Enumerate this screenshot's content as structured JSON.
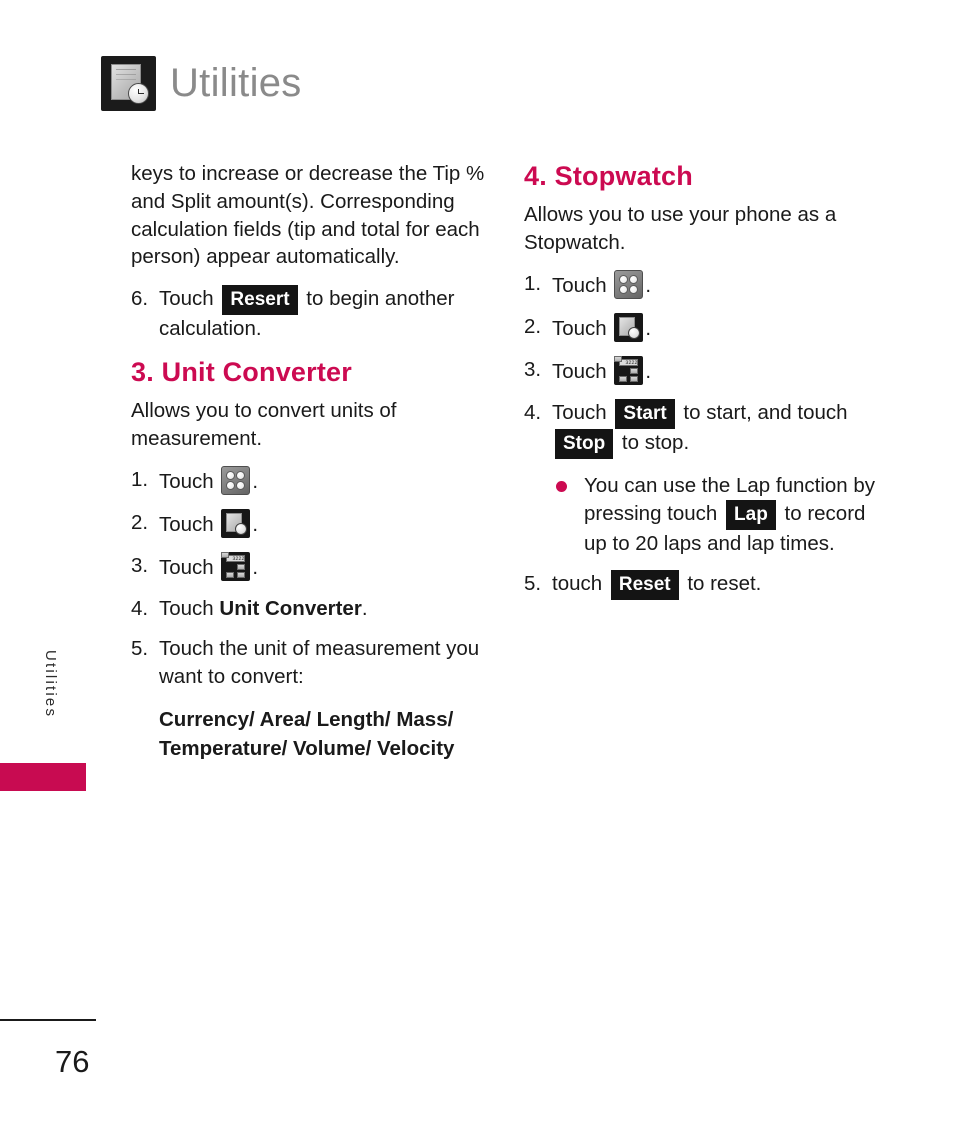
{
  "header": {
    "title": "Utilities",
    "icon": "utilities-clock-icon"
  },
  "side_tab": {
    "label": "Utilities",
    "color": "#c80b51"
  },
  "footer": {
    "page_number": "76"
  },
  "theme": {
    "heading_color": "#cc0a51",
    "bullet_color": "#cc0a51",
    "chip_bg": "#141414",
    "header_title_color": "#8a8a8a"
  },
  "left_column": {
    "continued_paragraph": "keys to increase or decrease the Tip % and Split amount(s). Corresponding calculation fields (tip and total for each person) appear automatically.",
    "step6": {
      "num": "6.",
      "text_before": "Touch",
      "chip": "Resert",
      "text_after": "to begin another calculation."
    },
    "section": {
      "heading": "3. Unit Converter",
      "intro": "Allows you to convert units of measurement.",
      "steps": [
        {
          "num": "1.",
          "text_before": "Touch",
          "icon": "grid-menu-icon",
          "text_after": "."
        },
        {
          "num": "2.",
          "text_before": "Touch",
          "icon": "utilities-clock-icon",
          "text_after": "."
        },
        {
          "num": "3.",
          "text_before": "Touch",
          "icon": "calculator-icon",
          "text_after": "."
        },
        {
          "num": "4.",
          "text_before": "Touch",
          "bold": "Unit Converter",
          "text_after": "."
        },
        {
          "num": "5.",
          "text_before": "Touch the unit of measurement you want to convert:"
        }
      ],
      "unit_list": "Currency/ Area/ Length/ Mass/ Temperature/ Volume/ Velocity"
    }
  },
  "right_column": {
    "section": {
      "heading": "4. Stopwatch",
      "intro": "Allows you to use your phone as a Stopwatch.",
      "steps": [
        {
          "num": "1.",
          "text_before": "Touch",
          "icon": "grid-menu-icon",
          "text_after": "."
        },
        {
          "num": "2.",
          "text_before": "Touch",
          "icon": "utilities-clock-icon",
          "text_after": "."
        },
        {
          "num": "3.",
          "text_before": "Touch",
          "icon": "calculator-icon",
          "text_after": "."
        }
      ],
      "step4": {
        "num": "4.",
        "text_before": "Touch",
        "chip_start": "Start",
        "text_mid": "to start, and touch",
        "chip_stop": "Stop",
        "text_after": "to stop."
      },
      "bullet": {
        "text_before": "You can use the Lap function by pressing touch",
        "chip": "Lap",
        "text_after": "to record up to 20 laps and lap times."
      },
      "step5": {
        "num": "5.",
        "text_before": "touch",
        "chip": "Reset",
        "text_after": "to reset."
      }
    }
  }
}
